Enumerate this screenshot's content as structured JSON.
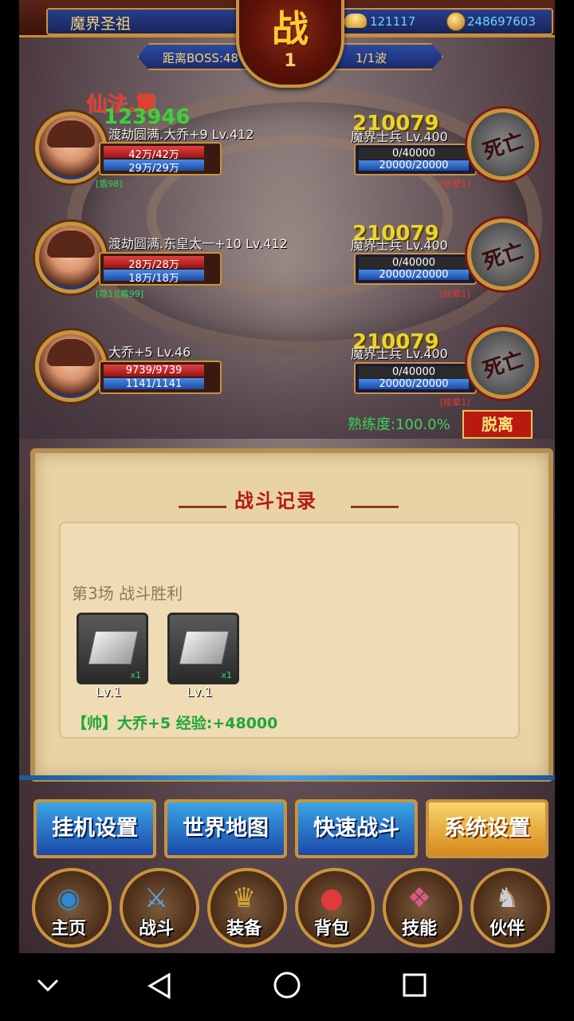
{
  "header": {
    "player_name": "魔界圣祖",
    "ingots": "121117",
    "coins": "248697603",
    "battle_char": "战",
    "battle_num": "1",
    "boss_distance": "距离BOSS:48",
    "wave": "1/1波"
  },
  "heroes": [
    {
      "name": "渡劫圆满.大乔+9 Lv.412",
      "hp": "42万/42万",
      "mp": "29万/29万",
      "tag": "[盾98]",
      "hp_fill": 1.0,
      "mp_fill": 1.0
    },
    {
      "name": "渡劫圆满.东皇太一+10 Lv.412",
      "hp": "28万/28万",
      "mp": "18万/18万",
      "tag": "[隐1][盾99]",
      "hp_fill": 1.0,
      "mp_fill": 1.0
    },
    {
      "name": "大乔+5 Lv.46",
      "hp": "9739/9739",
      "mp": "1141/1141",
      "tag": "",
      "hp_fill": 1.0,
      "mp_fill": 1.0
    }
  ],
  "enemies": [
    {
      "name": "魔界士兵 Lv.400",
      "damage": "210079",
      "hp": "0/40000",
      "mp": "20000/20000",
      "status": "死亡",
      "tag": "[眩晕1]"
    },
    {
      "name": "魔界士兵 Lv.400",
      "damage": "210079",
      "hp": "0/40000",
      "mp": "20000/20000",
      "status": "死亡",
      "tag": "[眩晕1]"
    },
    {
      "name": "魔界士兵 Lv.400",
      "damage": "210079",
      "hp": "0/40000",
      "mp": "20000/20000",
      "status": "死亡",
      "tag": "[眩晕1]"
    }
  ],
  "floating": {
    "skill": "仙法.震",
    "heal": "123946"
  },
  "proficiency": "熟练度:100.0%",
  "leave_label": "脱离",
  "log": {
    "title": "战斗记录",
    "headline": "第3场 战斗胜利",
    "items": [
      {
        "qty": "x1",
        "level": "Lv.1"
      },
      {
        "qty": "x1",
        "level": "Lv.1"
      }
    ],
    "line1": "【帅】大乔+5 经验:+48000"
  },
  "menu": {
    "idle": "挂机设置",
    "world": "世界地图",
    "quick": "快速战斗",
    "system": "系统设置"
  },
  "nav": [
    {
      "label": "主页",
      "icon": "home-icon"
    },
    {
      "label": "战斗",
      "icon": "swords-icon"
    },
    {
      "label": "装备",
      "icon": "helmet-icon"
    },
    {
      "label": "背包",
      "icon": "bag-icon"
    },
    {
      "label": "技能",
      "icon": "skill-icon"
    },
    {
      "label": "伙伴",
      "icon": "partner-icon"
    }
  ],
  "colors": {
    "accent_gold": "#c9933d",
    "hp_red": "#e04040",
    "mp_blue": "#4a8ae6",
    "green_text": "#3ad25a"
  }
}
